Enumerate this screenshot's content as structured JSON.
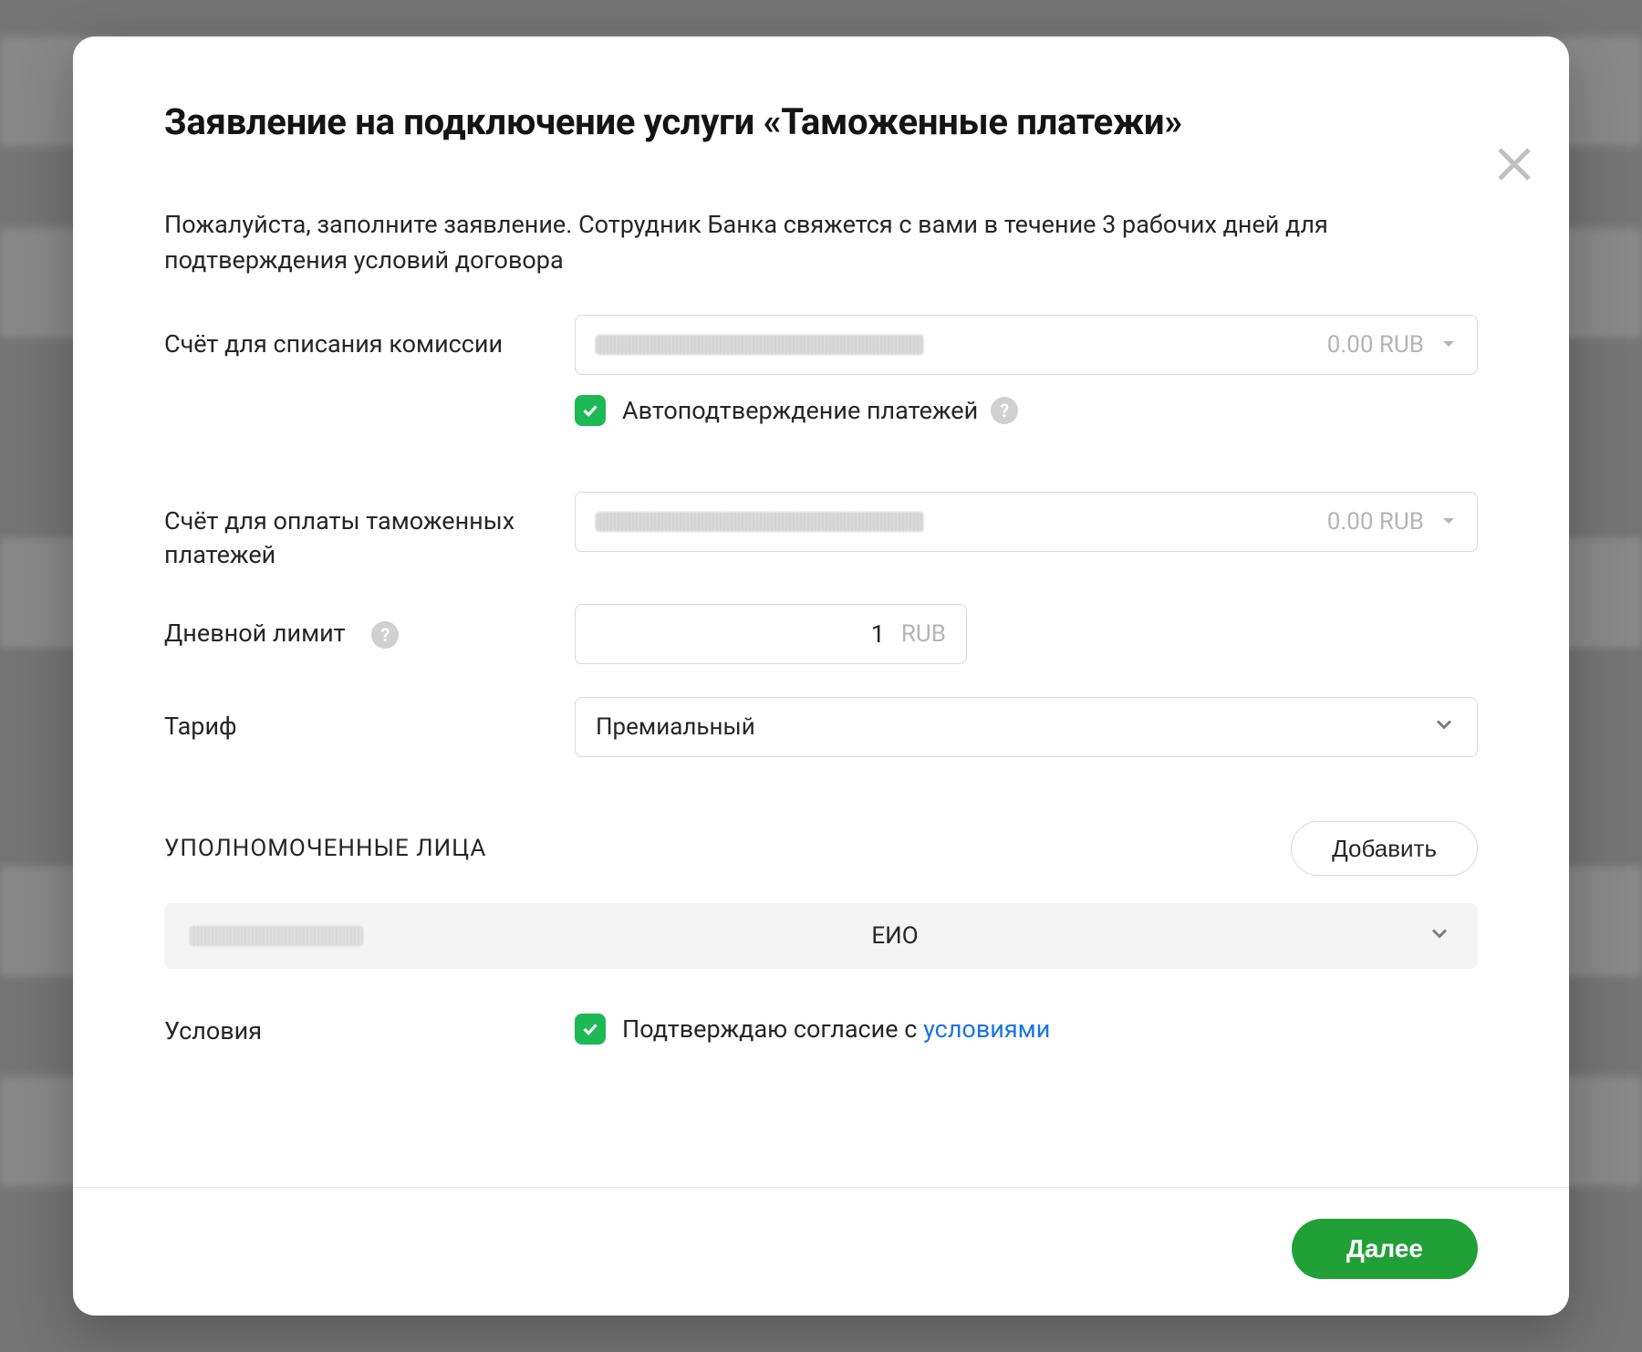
{
  "modal": {
    "title": "Заявление на подключение услуги «Таможенные платежи»",
    "description": "Пожалуйста, заполните заявление. Сотрудник Банка свяжется с вами в течение 3 рабочих дней для подтверждения условий договора",
    "fields": {
      "commission_account": {
        "label": "Счёт для списания комиссии",
        "balance": "0.00 RUB"
      },
      "autoconfirm": {
        "label": "Автоподтверждение платежей",
        "checked": true
      },
      "customs_account": {
        "label": "Счёт для оплаты таможенных платежей",
        "balance": "0.00 RUB"
      },
      "daily_limit": {
        "label": "Дневной лимит",
        "value": "1",
        "unit": "RUB"
      },
      "tariff": {
        "label": "Тариф",
        "value": "Премиальный"
      }
    },
    "authorized": {
      "section_title": "УПОЛНОМОЧЕННЫЕ ЛИЦА",
      "add_label": "Добавить",
      "items": [
        {
          "role": "ЕИО"
        }
      ]
    },
    "terms": {
      "label": "Условия",
      "agree_prefix": "Подтверждаю согласие с ",
      "agree_link": "условиями",
      "checked": true
    },
    "footer": {
      "next": "Далее"
    }
  }
}
